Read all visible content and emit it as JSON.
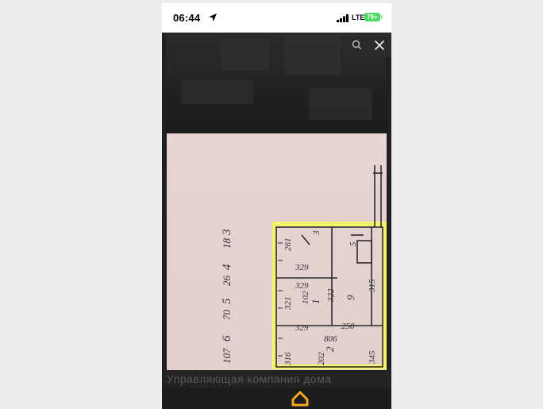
{
  "status_bar": {
    "time": "06:44",
    "network": "LTE",
    "battery": "79+"
  },
  "viewer": {
    "search_icon": "search-icon",
    "close_icon": "close-icon",
    "floor_plan": {
      "margin_numbers": [
        "3",
        "18",
        "4",
        "26",
        "5",
        "70",
        "6",
        "107"
      ],
      "room_labels": [
        "3",
        "261",
        "329",
        "329",
        "1",
        "102",
        "321",
        "322",
        "9",
        "315",
        "329",
        "250",
        "5",
        "806",
        "2",
        "202",
        "316",
        "345"
      ]
    },
    "bottom_text": "Управляющая компания дома"
  },
  "bottom_bar": {
    "logo_icon": "home-logo-icon"
  },
  "colors": {
    "accent_orange": "#f5a623",
    "battery_green": "#4cd964",
    "plan_yellow": "#f4f46b"
  }
}
